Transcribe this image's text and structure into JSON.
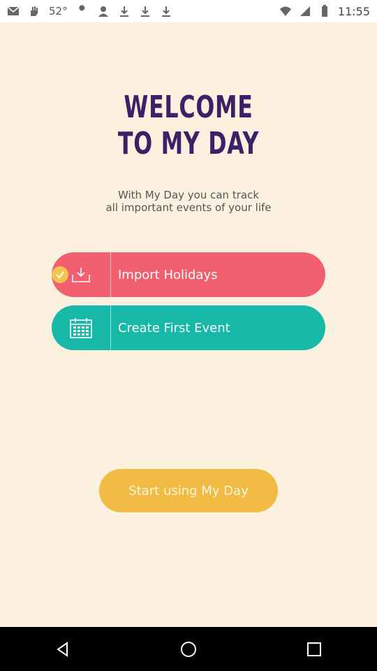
{
  "status_bar": {
    "temperature": "52°",
    "time": "11:55"
  },
  "welcome": {
    "title_line1": "WELCOME",
    "title_line2": "TO MY DAY",
    "subtitle_line1": "With My Day you can track",
    "subtitle_line2": "all important events of your life"
  },
  "actions": {
    "import_holidays": "Import Holidays",
    "create_first_event": "Create First Event"
  },
  "cta": {
    "label": "Start using My Day"
  },
  "colors": {
    "background": "#fcf1df",
    "title": "#3b2266",
    "import_button": "#f2606f",
    "create_button": "#18b8a8",
    "cta_button": "#f2bb43",
    "check_badge": "#f2c34e"
  },
  "icons": {
    "check": "check-icon",
    "import": "download-tray-icon",
    "calendar": "calendar-icon",
    "back": "back-icon",
    "home": "home-icon",
    "recents": "recents-icon"
  }
}
